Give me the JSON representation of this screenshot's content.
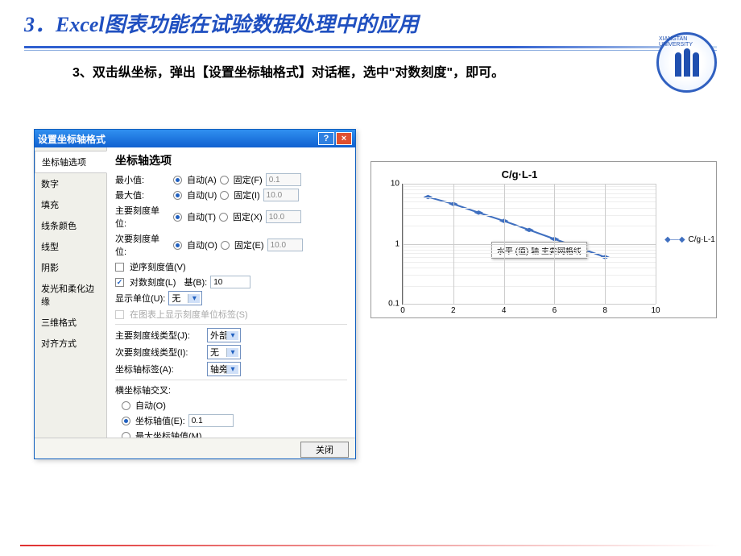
{
  "slide": {
    "title": "3．Excel图表功能在试验数据处理中的应用",
    "instruction": "3、双击纵坐标，弹出【设置坐标轴格式】对话框，选中\"对数刻度\"，即可。"
  },
  "dialog": {
    "title": "设置坐标轴格式",
    "help": "?",
    "close": "×",
    "sidebar": [
      "坐标轴选项",
      "数字",
      "填充",
      "线条颜色",
      "线型",
      "阴影",
      "发光和柔化边缘",
      "三维格式",
      "对齐方式"
    ],
    "panel_title": "坐标轴选项",
    "rows": {
      "min": {
        "label": "最小值:",
        "auto": "自动(A)",
        "fixed": "固定(F)",
        "value": "0.1"
      },
      "max": {
        "label": "最大值:",
        "auto": "自动(U)",
        "fixed": "固定(I)",
        "value": "10.0"
      },
      "major": {
        "label": "主要刻度单位:",
        "auto": "自动(T)",
        "fixed": "固定(X)",
        "value": "10.0"
      },
      "minor": {
        "label": "次要刻度单位:",
        "auto": "自动(O)",
        "fixed": "固定(E)",
        "value": "10.0"
      }
    },
    "reverse": "逆序刻度值(V)",
    "log": {
      "label": "对数刻度(L)",
      "base_label": "基(B):",
      "base_value": "10"
    },
    "display_unit": {
      "label": "显示单位(U):",
      "value": "无"
    },
    "show_unit_label": "在图表上显示刻度单位标签(S)",
    "tick_major": {
      "label": "主要刻度线类型(J):",
      "value": "外部"
    },
    "tick_minor": {
      "label": "次要刻度线类型(I):",
      "value": "无"
    },
    "axis_labels": {
      "label": "坐标轴标签(A):",
      "value": "轴旁"
    },
    "crosses_title": "横坐标轴交叉:",
    "crosses": {
      "auto": "自动(O)",
      "value": {
        "label": "坐标轴值(E):",
        "value": "0.1"
      },
      "max": "最大坐标轴值(M)"
    },
    "close_btn": "关闭"
  },
  "chart_data": {
    "type": "line",
    "title": "C/g·L-1",
    "series_name": "C/g·L-1",
    "x": [
      1,
      2,
      3,
      4,
      5,
      6,
      7,
      8
    ],
    "y": [
      6.0,
      4.6,
      3.3,
      2.4,
      1.7,
      1.2,
      0.85,
      0.6
    ],
    "xlim": [
      0,
      10
    ],
    "xticks": [
      0,
      2,
      4,
      6,
      8,
      10
    ],
    "ylim": [
      0.1,
      10
    ],
    "yticks": [
      0.1,
      1,
      10
    ],
    "yscale": "log",
    "tooltip": "水平 (值) 轴 主要网格线"
  }
}
